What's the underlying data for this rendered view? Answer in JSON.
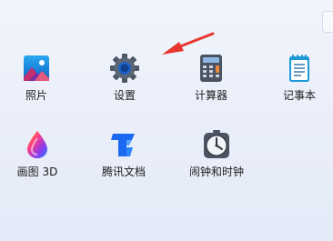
{
  "apps": [
    {
      "id": "photos",
      "label": "照片",
      "icon": "photos-icon"
    },
    {
      "id": "settings",
      "label": "设置",
      "icon": "gear-icon"
    },
    {
      "id": "calculator",
      "label": "计算器",
      "icon": "calculator-icon"
    },
    {
      "id": "notepad",
      "label": "记事本",
      "icon": "notepad-icon"
    },
    {
      "id": "paint3d",
      "label": "画图 3D",
      "icon": "paint3d-icon"
    },
    {
      "id": "tencent-docs",
      "label": "腾讯文档",
      "icon": "tencent-docs-icon"
    },
    {
      "id": "alarms-clock",
      "label": "闹钟和时钟",
      "icon": "clock-icon"
    }
  ],
  "annotation": {
    "color": "#e8372e",
    "points_to": "settings"
  }
}
